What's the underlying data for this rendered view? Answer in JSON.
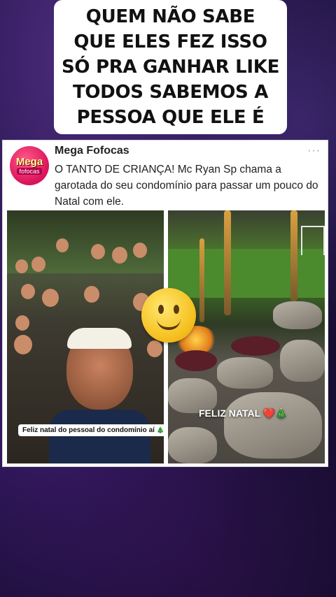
{
  "caption": {
    "text": "QUEM NÃO SABE\nQUE ELES FEZ ISSO\nSÓ PRA GANHAR LIKE\nTODOS SABEMOS A\nPESSOA QUE ELE É"
  },
  "post": {
    "avatar_title": "Mega",
    "avatar_subtitle": "fofocas",
    "account_name": "Mega Fofocas",
    "more_icon": "···",
    "text": "O TANTO DE CRIANÇA! Mc Ryan Sp chama a garotada do seu condomínio para passar um pouco do Natal com ele.",
    "left_video": {
      "subtitle": "Feliz natal do pessoal do condomínio aí",
      "subtitle_emoji": "🎄😁"
    },
    "right_video": {
      "subtitle": "FELIZ NATAL",
      "subtitle_emoji": "❤️🎄"
    }
  },
  "overlay": {
    "icon": "slightly-smiling-face-emoji-icon"
  },
  "colors": {
    "background": "#1a0f38",
    "caption_bg": "#ffffff",
    "avatar": "#d9135a"
  }
}
